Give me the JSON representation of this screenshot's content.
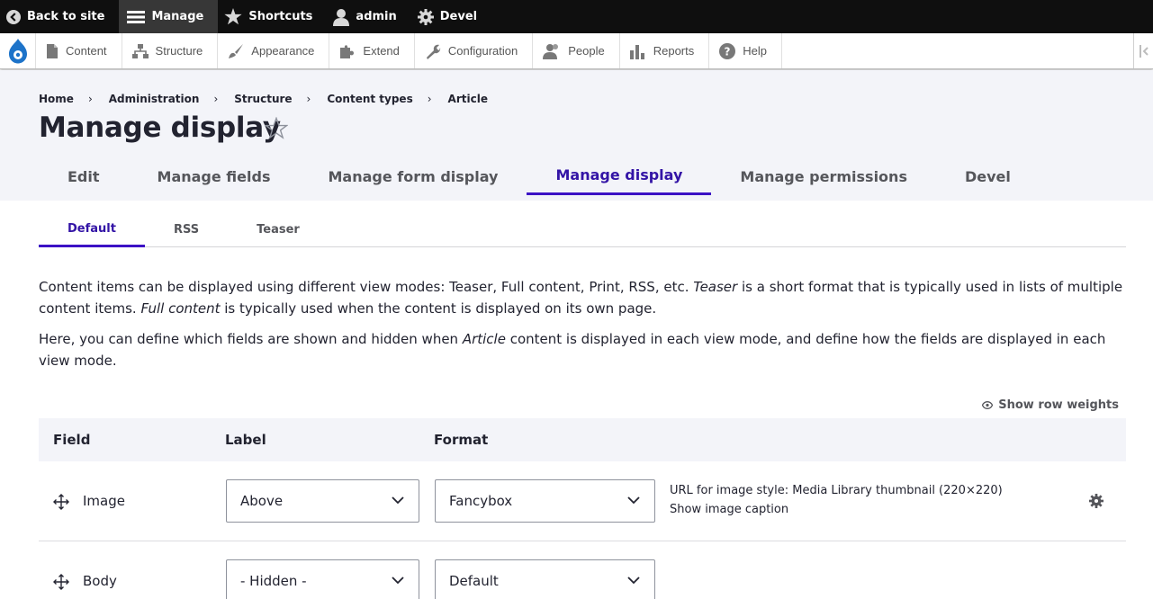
{
  "toolbar": {
    "back_label": "Back to site",
    "manage_label": "Manage",
    "shortcuts_label": "Shortcuts",
    "user_label": "admin",
    "devel_label": "Devel"
  },
  "tray": {
    "items": [
      "Content",
      "Structure",
      "Appearance",
      "Extend",
      "Configuration",
      "People",
      "Reports",
      "Help"
    ]
  },
  "breadcrumb": [
    "Home",
    "Administration",
    "Structure",
    "Content types",
    "Article"
  ],
  "breadcrumb_separator": "›",
  "page_title": "Manage display",
  "primary_tabs": [
    "Edit",
    "Manage fields",
    "Manage form display",
    "Manage display",
    "Manage permissions",
    "Devel"
  ],
  "primary_active": "Manage display",
  "secondary_tabs": [
    "Default",
    "RSS",
    "Teaser"
  ],
  "secondary_active": "Default",
  "description": {
    "p1_a": "Content items can be displayed using different view modes: Teaser, Full content, Print, RSS, etc. ",
    "p1_em1": "Teaser",
    "p1_b": " is a short format that is typically used in lists of multiple content items. ",
    "p1_em2": "Full content",
    "p1_c": " is typically used when the content is displayed on its own page.",
    "p2_a": "Here, you can define which fields are shown and hidden when ",
    "p2_em": "Article",
    "p2_b": " content is displayed in each view mode, and define how the fields are displayed in each view mode."
  },
  "show_row_weights": "Show row weights",
  "table": {
    "headers": {
      "field": "Field",
      "label": "Label",
      "format": "Format"
    },
    "rows": [
      {
        "field": "Image",
        "label": "Above",
        "format": "Fancybox",
        "summary": [
          "URL for image style: Media Library thumbnail (220×220)",
          "Show image caption"
        ]
      },
      {
        "field": "Body",
        "label": "- Hidden -",
        "format": "Default"
      }
    ]
  },
  "colors": {
    "accent": "#3c12c5",
    "toolbar_bg": "#0f0f0f",
    "header_bg": "#f3f4f9"
  }
}
